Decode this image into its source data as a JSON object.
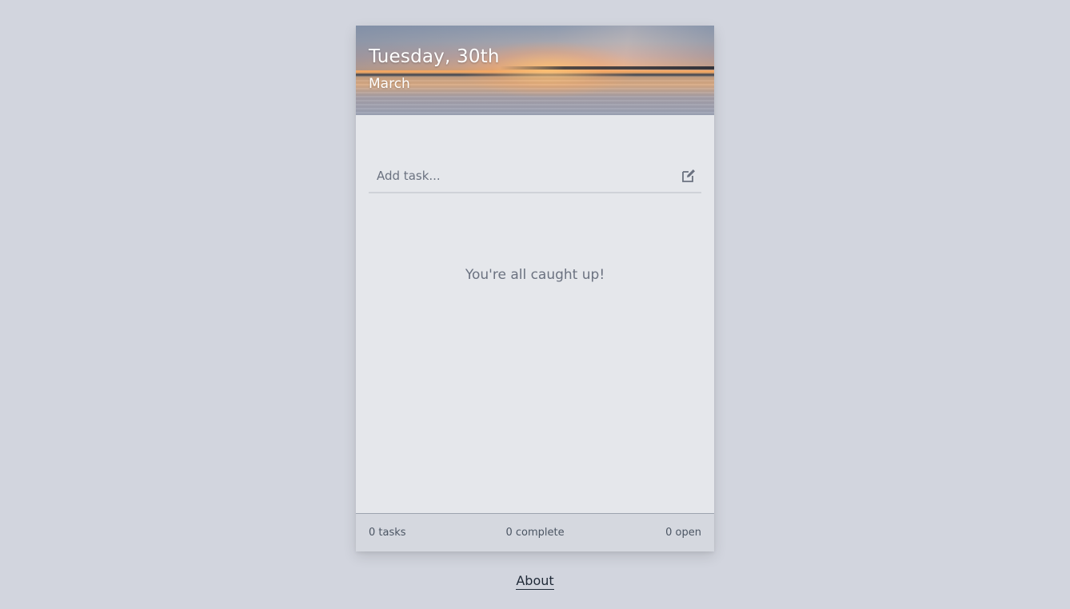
{
  "header": {
    "day_line": "Tuesday, 30th",
    "month_line": "March"
  },
  "add_task": {
    "placeholder": "Add task...",
    "value": "",
    "icon": "edit-icon"
  },
  "empty_state": {
    "message": "You're all caught up!"
  },
  "footer": {
    "tasks": "0 tasks",
    "complete": "0 complete",
    "open": "0 open"
  },
  "links": {
    "about": "About"
  },
  "colors": {
    "page_background": "#d2d5de",
    "card_background": "#e5e7eb",
    "footer_background": "#d5d8df",
    "muted_text": "#6b7280"
  }
}
